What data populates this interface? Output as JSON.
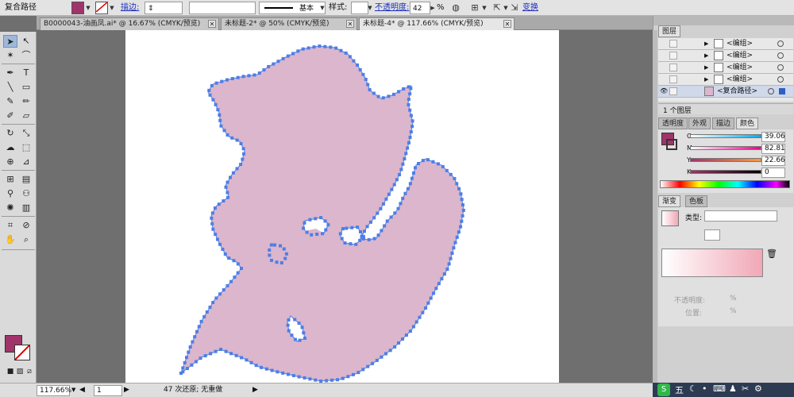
{
  "control_bar": {
    "object_type": "复合路径",
    "stroke_link": "描边:",
    "stroke_profile": "基本",
    "style_label": "样式:",
    "opacity_link": "不透明度:",
    "opacity_value": "42",
    "opacity_unit": "%",
    "transform_link": "变换",
    "fill_color": "#a0346a"
  },
  "tabs": [
    {
      "label": "B0000043-油画凤.ai* @ 16.67% (CMYK/预览)"
    },
    {
      "label": "未标题-2* @ 50% (CMYK/预览)"
    },
    {
      "label": "未标题-4* @ 117.66% (CMYK/预览)"
    }
  ],
  "artwork": {
    "fill": "#dbb6cc",
    "anchor_color": "#4d7ee6"
  },
  "layers_panel": {
    "title": "图层",
    "rows": [
      {
        "name": "<编组>"
      },
      {
        "name": "<编组>"
      },
      {
        "name": "<编组>"
      },
      {
        "name": "<编组>"
      },
      {
        "name": "<复合路径>"
      }
    ],
    "footer": "1 个图层"
  },
  "color_panel": {
    "tabs": [
      "透明度",
      "外观",
      "描边",
      "颜色"
    ],
    "channels": [
      {
        "label": "C",
        "value": "39.06"
      },
      {
        "label": "M",
        "value": "82.81"
      },
      {
        "label": "Y",
        "value": "22.66"
      },
      {
        "label": "K",
        "value": "0"
      }
    ]
  },
  "gradient_panel": {
    "tabs": [
      "渐变",
      "色板"
    ],
    "type_label": "类型:",
    "opacity_label": "不透明度:",
    "position_label": "位置:",
    "percent": "%"
  },
  "status_bar": {
    "zoom": "117.66%",
    "artboard": "1",
    "undo_text": "47 次还原; 无重做"
  },
  "taskbar": {
    "ime": "五"
  }
}
